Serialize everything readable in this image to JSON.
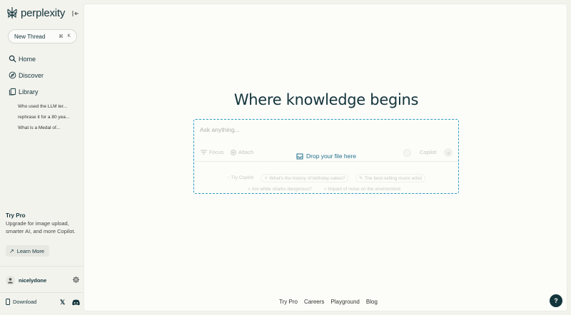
{
  "brand": {
    "name": "perplexity"
  },
  "sidebar": {
    "new_thread": {
      "label": "New Thread",
      "shortcut_mod": "⌘",
      "shortcut_key": "K"
    },
    "nav": [
      {
        "label": "Home",
        "icon": "search-icon"
      },
      {
        "label": "Discover",
        "icon": "compass-icon"
      },
      {
        "label": "Library",
        "icon": "library-icon"
      }
    ],
    "library_items": [
      "Who used the LLM ter...",
      "rephrase it for a 80 yea...",
      "What is a Medal of..."
    ],
    "try_pro": {
      "title": "Try Pro",
      "description": "Upgrade for image upload, smarter AI, and more Copilot.",
      "button": "Learn More"
    },
    "user": {
      "name": "nicelydone"
    },
    "download": {
      "label": "Download"
    }
  },
  "main": {
    "headline": "Where knowledge begins",
    "search": {
      "placeholder": "Ask anything...",
      "focus_label": "Focus",
      "attach_label": "Attach",
      "drop_label": "Drop your file here",
      "copilot_label": "Copilot"
    },
    "suggestions": [
      {
        "label": "Try Copilot",
        "icon": "copilot-icon"
      },
      {
        "label": "What's the history of birthday cakes?",
        "icon": "sparkle-icon"
      },
      {
        "label": "The best-selling music artist",
        "icon": "pencil-icon"
      },
      {
        "label": "Are white sharks dangerous?",
        "icon": "wave-icon"
      },
      {
        "label": "Impact of noise on the environment",
        "icon": "wave-icon"
      }
    ],
    "footer": [
      "Try Pro",
      "Careers",
      "Playground",
      "Blog"
    ],
    "help": "?"
  },
  "colors": {
    "accent": "#20708c",
    "dashed_border": "#2a9dc0",
    "text": "#13343b"
  }
}
